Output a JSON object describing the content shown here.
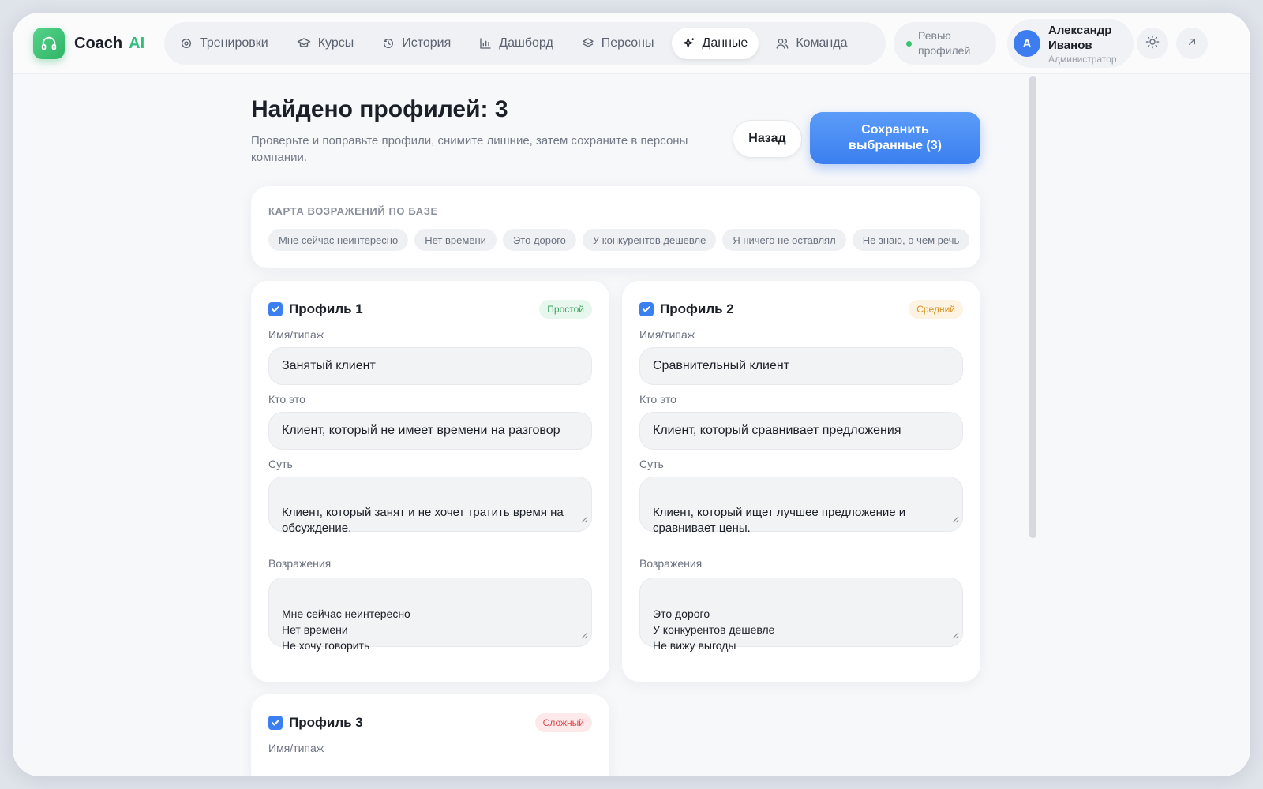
{
  "app": {
    "name": "Coach",
    "ai_suffix": "AI"
  },
  "nav": [
    {
      "label": "Тренировки",
      "icon": "target-icon"
    },
    {
      "label": "Курсы",
      "icon": "graduation-cap-icon"
    },
    {
      "label": "История",
      "icon": "history-icon"
    },
    {
      "label": "Дашборд",
      "icon": "bar-chart-icon"
    },
    {
      "label": "Персоны",
      "icon": "layers-icon"
    },
    {
      "label": "Данные",
      "icon": "sparkles-icon",
      "active": true
    },
    {
      "label": "Команда",
      "icon": "users-icon"
    }
  ],
  "review": {
    "label": "Ревью профилей"
  },
  "user": {
    "initial": "А",
    "name": "Александр Иванов",
    "role": "Администратор"
  },
  "page": {
    "title": "Найдено профилей: 3",
    "subtitle": "Проверьте и поправьте профили, снимите лишние, затем сохраните в персоны компании.",
    "back_label": "Назад",
    "save_label": "Сохранить выбранные (3)"
  },
  "objection_map": {
    "title": "КАРТА ВОЗРАЖЕНИЙ ПО БАЗЕ",
    "chips": [
      "Мне сейчас неинтересно",
      "Нет времени",
      "Это дорого",
      "У конкурентов дешевле",
      "Я ничего не оставлял",
      "Не знаю, о чем речь"
    ]
  },
  "labels": {
    "name": "Имя/типаж",
    "who": "Кто это",
    "essence": "Суть",
    "objections": "Возражения"
  },
  "profiles": [
    {
      "title": "Профиль 1",
      "checked": true,
      "difficulty": "Простой",
      "name": "Занятый клиент",
      "who": "Клиент, который не имеет времени на разговор",
      "essence": "Клиент, который занят и не хочет тратить время на обсуждение.",
      "objections": "Мне сейчас неинтересно\nНет времени\nНе хочу говорить"
    },
    {
      "title": "Профиль 2",
      "checked": true,
      "difficulty": "Средний",
      "name": "Сравнительный клиент",
      "who": "Клиент, который сравнивает предложения",
      "essence": "Клиент, который ищет лучшее предложение и сравнивает цены.",
      "objections": "Это дорого\nУ конкурентов дешевле\nНе вижу выгоды"
    },
    {
      "title": "Профиль 3",
      "checked": true,
      "difficulty": "Сложный"
    }
  ],
  "colors": {
    "accent": "#3b7ff0",
    "brand": "#2fbf7a",
    "easy": "#3aa35f",
    "medium": "#d99227",
    "hard": "#d9474f"
  }
}
